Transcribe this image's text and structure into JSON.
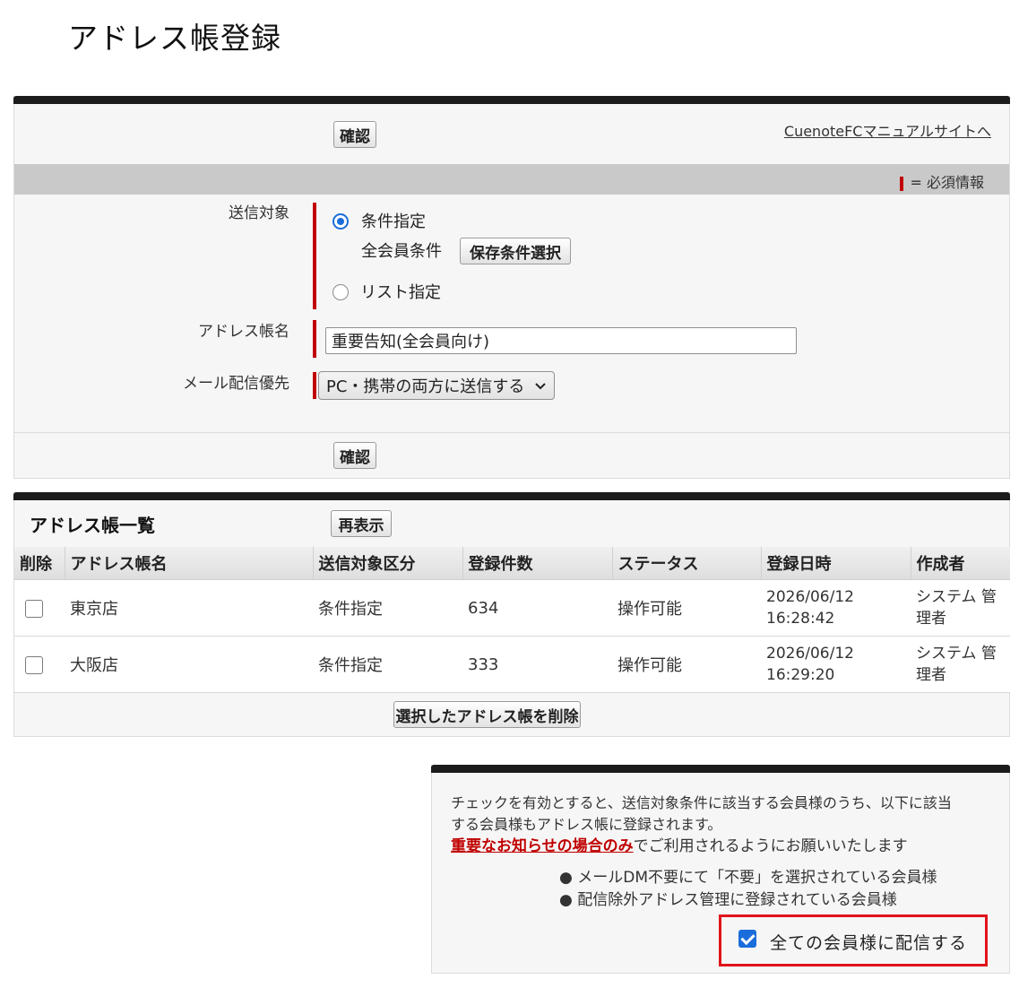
{
  "page": {
    "title": "アドレス帳登録"
  },
  "form": {
    "confirm_label": "確認",
    "manual_link": "CuenoteFCマニュアルサイトへ",
    "required_legend": "= 必須情報",
    "target": {
      "label": "送信対象",
      "option_condition": "条件指定",
      "condition_value": "全会員条件",
      "saved_condition_button": "保存条件選択",
      "option_list": "リスト指定"
    },
    "name": {
      "label": "アドレス帳名",
      "value": "重要告知(全会員向け)"
    },
    "delivery": {
      "label": "メール配信優先",
      "selected": "PC・携帯の両方に送信する"
    }
  },
  "list": {
    "title": "アドレス帳一覧",
    "refresh_label": "再表示",
    "columns": [
      "削除",
      "アドレス帳名",
      "送信対象区分",
      "登録件数",
      "ステータス",
      "登録日時",
      "作成者"
    ],
    "rows": [
      {
        "name": "東京店",
        "type": "条件指定",
        "count": "634",
        "status": "操作可能",
        "date": "2026/06/12",
        "time": "16:28:42",
        "creator_line1": "システム 管",
        "creator_line2": "理者"
      },
      {
        "name": "大阪店",
        "type": "条件指定",
        "count": "333",
        "status": "操作可能",
        "date": "2026/06/12",
        "time": "16:29:20",
        "creator_line1": "システム 管",
        "creator_line2": "理者"
      }
    ],
    "delete_button": "選択したアドレス帳を削除"
  },
  "notice": {
    "line1": "チェックを有効とすると、送信対象条件に該当する会員様のうち、以下に該当",
    "line2": "する会員様もアドレス帳に登録されます。",
    "important_link": "重要なお知らせの場合のみ",
    "line3_rest": "でご利用されるようにお願いいたします",
    "bullets": [
      "メールDM不要にて「不要」を選択されている会員様",
      "配信除外アドレス管理に登録されている会員様"
    ],
    "checkbox_label": "全ての会員様に配信する"
  }
}
